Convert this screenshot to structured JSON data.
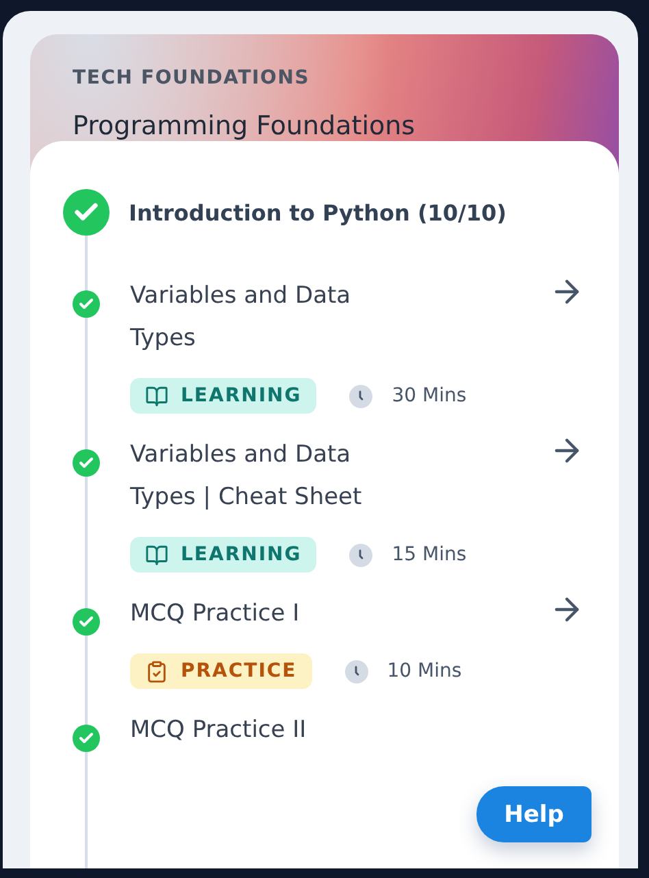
{
  "header": {
    "eyebrow": "TECH FOUNDATIONS",
    "title": "Programming Foundations"
  },
  "module": {
    "title": "Introduction to Python (10/10)",
    "completed": true
  },
  "lessons": [
    {
      "title": "Variables and Data Types",
      "completed": true,
      "kind": "learning",
      "tag": "LEARNING",
      "duration": "30 Mins"
    },
    {
      "title": "Variables and Data Types | Cheat Sheet",
      "completed": true,
      "kind": "learning",
      "tag": "LEARNING",
      "duration": "15 Mins"
    },
    {
      "title": "MCQ Practice I",
      "completed": true,
      "kind": "practice",
      "tag": "PRACTICE",
      "duration": "10 Mins"
    },
    {
      "title": "MCQ Practice II",
      "completed": true,
      "kind": "plain"
    }
  ],
  "help_button": "Help"
}
